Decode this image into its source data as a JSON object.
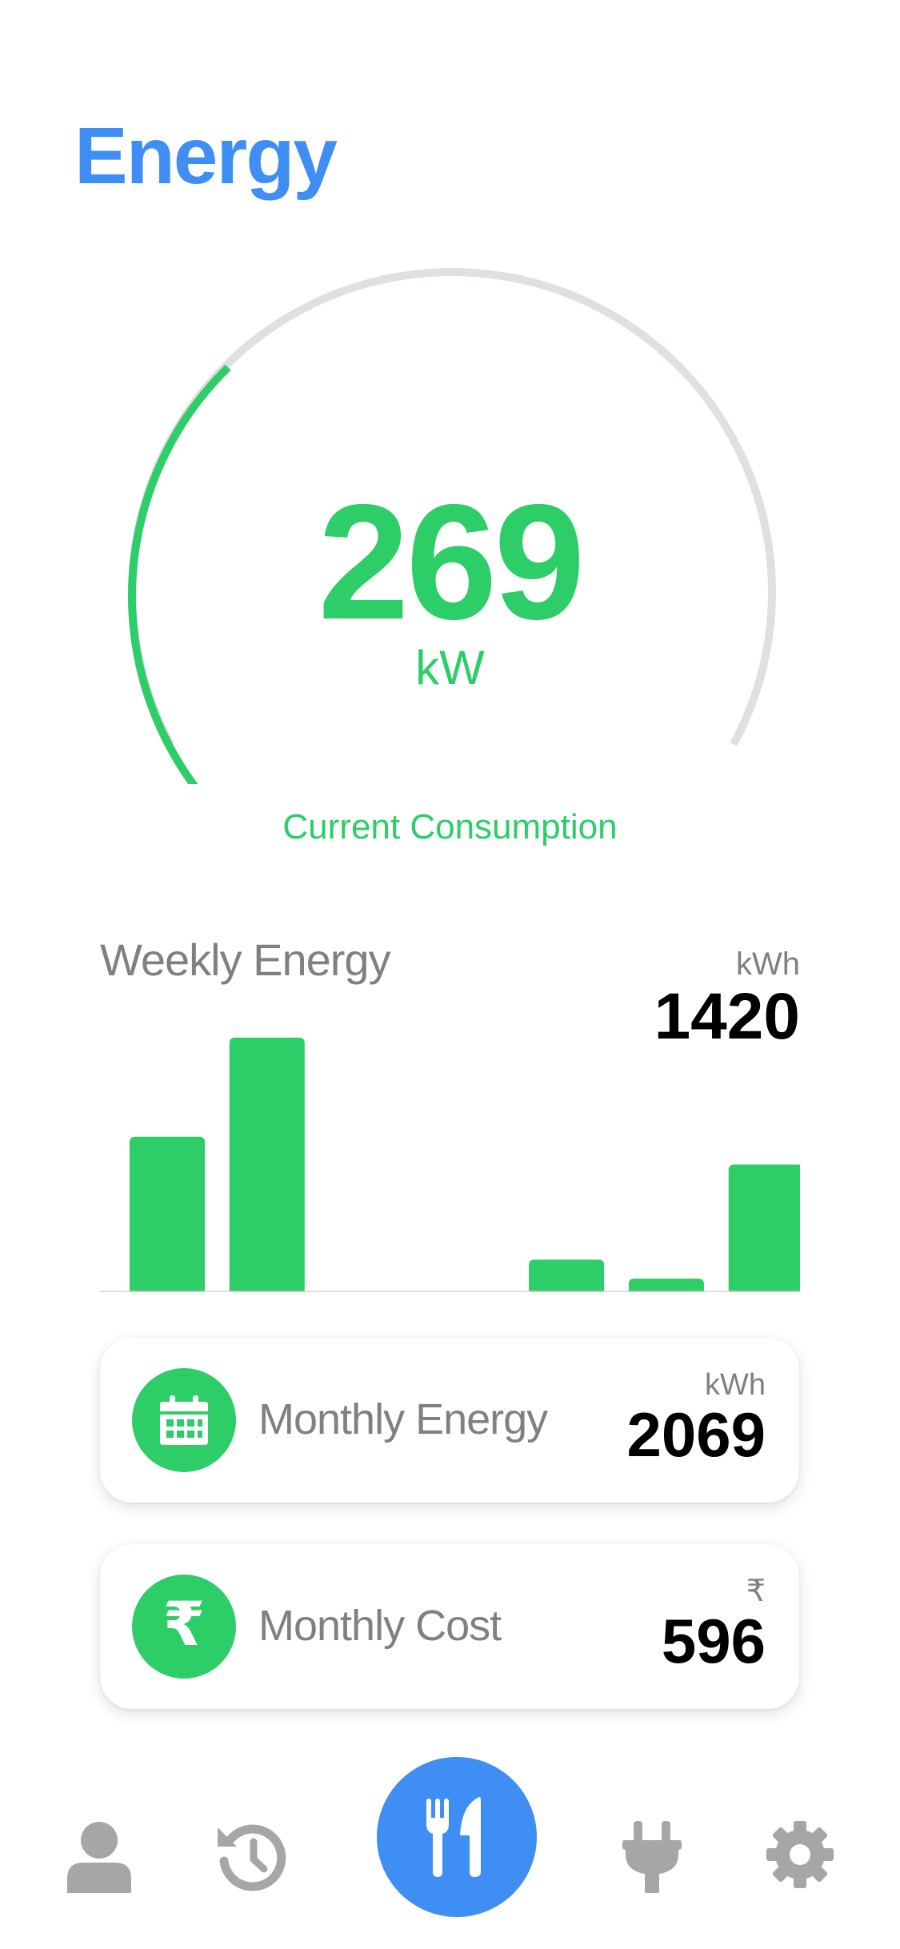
{
  "header": {
    "title": "Energy"
  },
  "gauge": {
    "value": "269",
    "unit": "kW",
    "caption": "Current Consumption",
    "fill_fraction": 0.44,
    "active_color": "#2dcd68",
    "track_color": "#e2dfdf"
  },
  "weekly": {
    "title": "Weekly Energy",
    "unit": "kWh",
    "total": "1420"
  },
  "chart_data": {
    "type": "bar",
    "categories": [
      "",
      "",
      "",
      "",
      "",
      "",
      ""
    ],
    "values": [
      390,
      640,
      0,
      0,
      80,
      32,
      320
    ],
    "ylim": [
      0,
      700
    ],
    "grid": false,
    "bar_color": "#2dcd68"
  },
  "cards": {
    "monthly_energy": {
      "label": "Monthly Energy",
      "unit": "kWh",
      "value": "2069",
      "icon": "calendar-icon"
    },
    "monthly_cost": {
      "label": "Monthly Cost",
      "unit": "₹",
      "value": "596",
      "icon": "rupee-icon",
      "icon_glyph": "₹"
    }
  },
  "tabbar": {
    "tabs": [
      {
        "icon": "person-icon",
        "active": false
      },
      {
        "icon": "history-icon",
        "active": false
      },
      {
        "icon": "fork-knife-icon",
        "active": true
      },
      {
        "icon": "plug-icon",
        "active": false
      },
      {
        "icon": "gear-icon",
        "active": false
      }
    ],
    "active_color": "#3f8ef4",
    "inactive_color": "#a6a6a6"
  }
}
